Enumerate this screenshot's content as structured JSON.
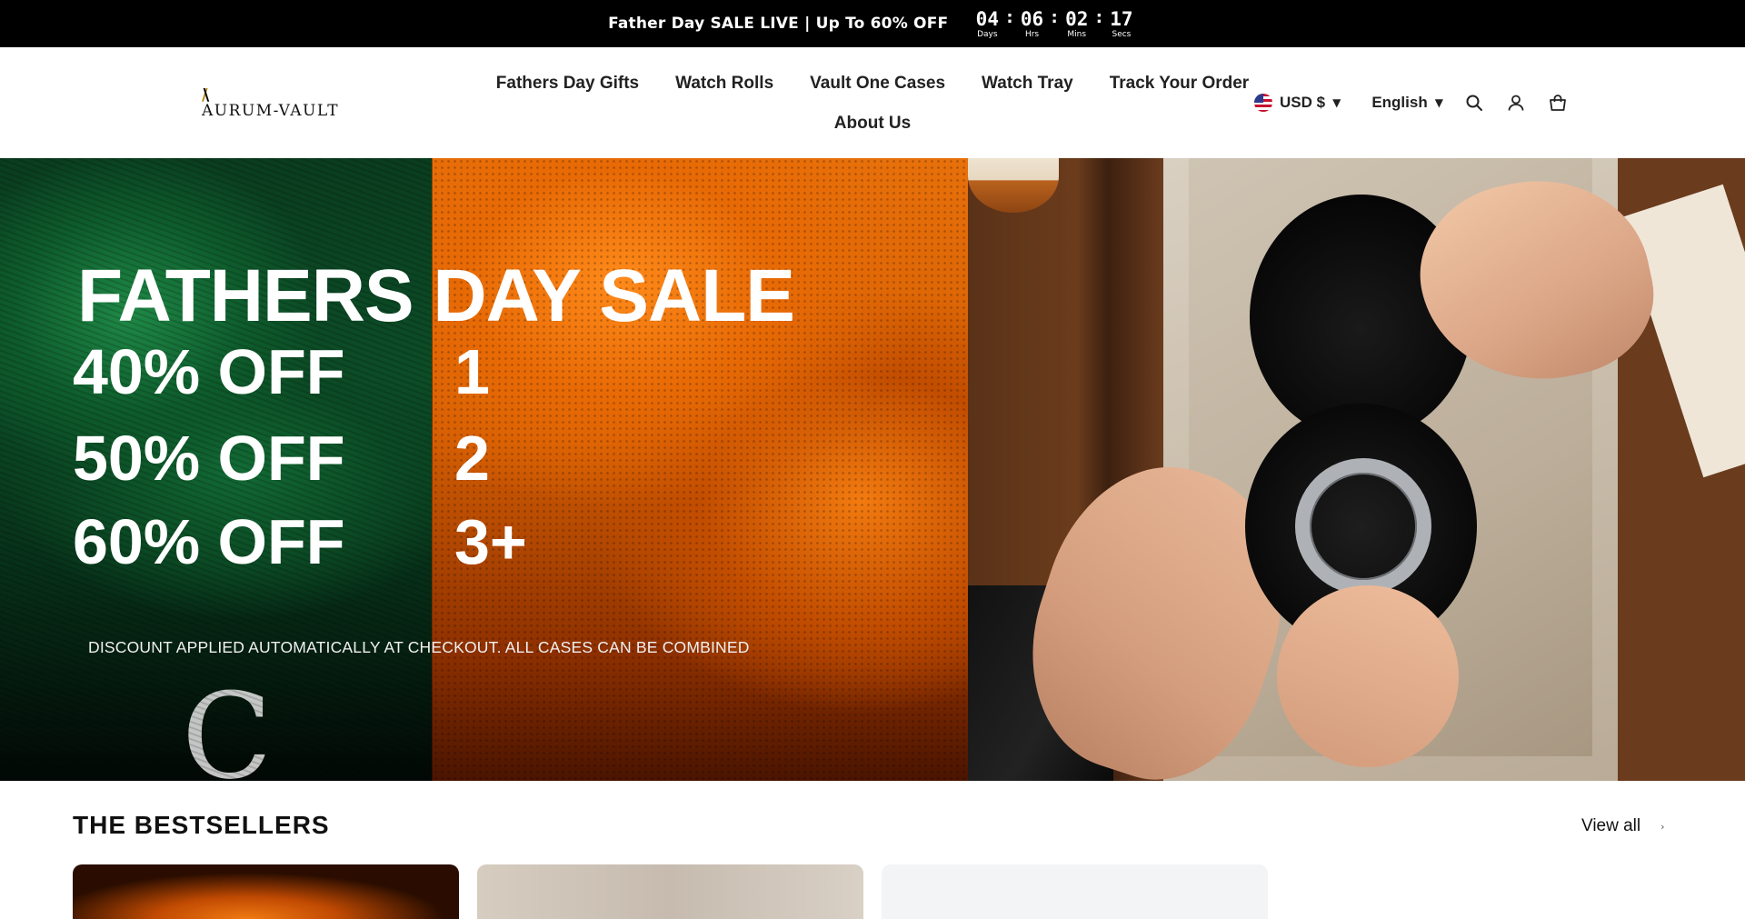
{
  "announcement": {
    "text": "Father Day SALE LIVE | Up To 60% OFF",
    "countdown": [
      {
        "value": "04",
        "label": "Days"
      },
      {
        "value": "06",
        "label": "Hrs"
      },
      {
        "value": "02",
        "label": "Mins"
      },
      {
        "value": "17",
        "label": "Secs"
      }
    ]
  },
  "header": {
    "logo_text": "AURUM-VAULT",
    "nav": [
      "Fathers Day Gifts",
      "Watch Rolls",
      "Vault One Cases",
      "Watch Tray",
      "Track Your Order",
      "About Us"
    ],
    "currency": "USD $",
    "language": "English"
  },
  "hero": {
    "title": "FATHERS DAY SALE",
    "tiers": [
      {
        "discount": "40% OFF",
        "qty": "1"
      },
      {
        "discount": "50% OFF",
        "qty": "2"
      },
      {
        "discount": "60% OFF",
        "qty": "3+"
      }
    ],
    "note": "DISCOUNT APPLIED AUTOMATICALLY AT CHECKOUT. ALL CASES CAN BE COMBINED"
  },
  "bestsellers": {
    "title": "THE BESTSELLERS",
    "view_all": "View all"
  },
  "colors": {
    "announcement_bg": "#000000",
    "accent_gold": "#b8861b"
  }
}
